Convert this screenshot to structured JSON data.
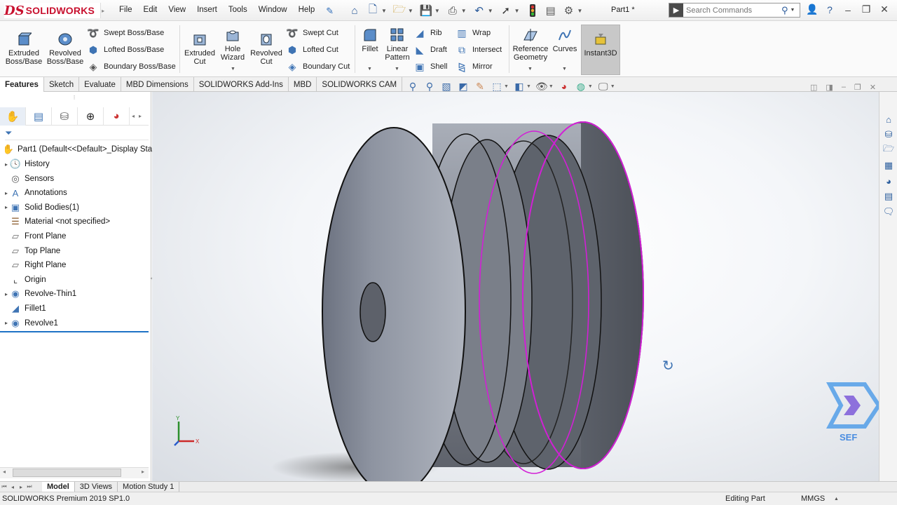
{
  "app": {
    "logo_ds": "DS",
    "logo_name": "SOLIDWORKS",
    "document_title": "Part1 *"
  },
  "menu": [
    "File",
    "Edit",
    "View",
    "Insert",
    "Tools",
    "Window",
    "Help"
  ],
  "search": {
    "placeholder": "Search Commands"
  },
  "ribbon": {
    "extruded_boss": "Extruded Boss/Base",
    "revolved_boss": "Revolved Boss/Base",
    "swept_boss": "Swept Boss/Base",
    "lofted_boss": "Lofted Boss/Base",
    "boundary_boss": "Boundary Boss/Base",
    "extruded_cut": "Extruded Cut",
    "hole_wizard": "Hole Wizard",
    "revolved_cut": "Revolved Cut",
    "swept_cut": "Swept Cut",
    "lofted_cut": "Lofted Cut",
    "boundary_cut": "Boundary Cut",
    "fillet": "Fillet",
    "linear_pattern": "Linear Pattern",
    "rib": "Rib",
    "wrap": "Wrap",
    "draft": "Draft",
    "intersect": "Intersect",
    "shell": "Shell",
    "mirror": "Mirror",
    "reference_geometry": "Reference Geometry",
    "curves": "Curves",
    "instant3d": "Instant3D"
  },
  "command_tabs": [
    "Features",
    "Sketch",
    "Evaluate",
    "MBD Dimensions",
    "SOLIDWORKS Add-Ins",
    "MBD",
    "SOLIDWORKS CAM"
  ],
  "feature_tree": {
    "root": "Part1  (Default<<Default>_Display Sta",
    "items": [
      {
        "label": "History",
        "expandable": true,
        "icon": "history-folder-icon"
      },
      {
        "label": "Sensors",
        "expandable": false,
        "icon": "sensors-icon"
      },
      {
        "label": "Annotations",
        "expandable": true,
        "icon": "annotations-icon"
      },
      {
        "label": "Solid Bodies(1)",
        "expandable": true,
        "icon": "solid-bodies-icon"
      },
      {
        "label": "Material <not specified>",
        "expandable": false,
        "icon": "material-icon"
      },
      {
        "label": "Front Plane",
        "expandable": false,
        "icon": "plane-icon"
      },
      {
        "label": "Top Plane",
        "expandable": false,
        "icon": "plane-icon"
      },
      {
        "label": "Right Plane",
        "expandable": false,
        "icon": "plane-icon"
      },
      {
        "label": "Origin",
        "expandable": false,
        "icon": "origin-icon"
      },
      {
        "label": "Revolve-Thin1",
        "expandable": true,
        "icon": "revolve-icon"
      },
      {
        "label": "Fillet1",
        "expandable": false,
        "icon": "fillet-icon"
      },
      {
        "label": "Revolve1",
        "expandable": true,
        "icon": "revolve-icon"
      }
    ]
  },
  "triad": {
    "x": "X",
    "y": "Y"
  },
  "watermark": {
    "text": "SEF"
  },
  "bottom_tabs": [
    "Model",
    "3D Views",
    "Motion Study 1"
  ],
  "status": {
    "version": "SOLIDWORKS Premium 2019 SP1.0",
    "mode": "Editing Part",
    "units": "MMGS"
  },
  "colors": {
    "accent": "#1e72c6",
    "selection": "#d21fd6",
    "brand": "#c8102e"
  }
}
